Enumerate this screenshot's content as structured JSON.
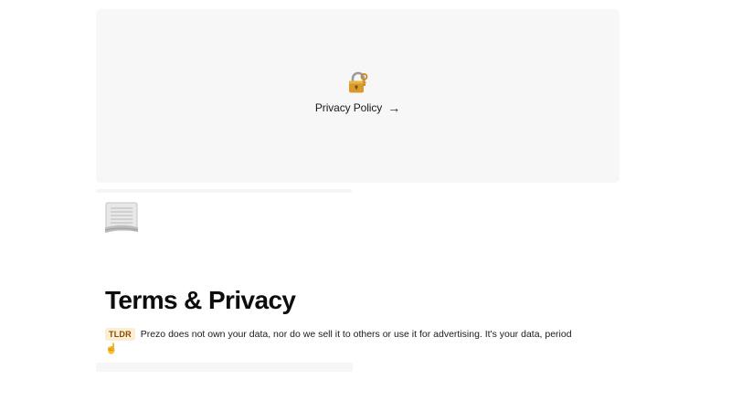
{
  "policy_card": {
    "link_label": "Privacy Policy",
    "arrow": "→",
    "icon": "lock-with-key-icon"
  },
  "document": {
    "icon": "documents-icon",
    "title": "Terms & Privacy",
    "tldr_badge": "TLDR",
    "tldr_text": "Prezo does not own your data, nor do we sell it to others or use it for advertising. It's your data, period",
    "tldr_emoji": "☝️"
  },
  "colors": {
    "card_background": "#f7f7f7",
    "badge_background": "#fbeed3",
    "badge_text": "#8a4a00",
    "text": "#111111"
  }
}
